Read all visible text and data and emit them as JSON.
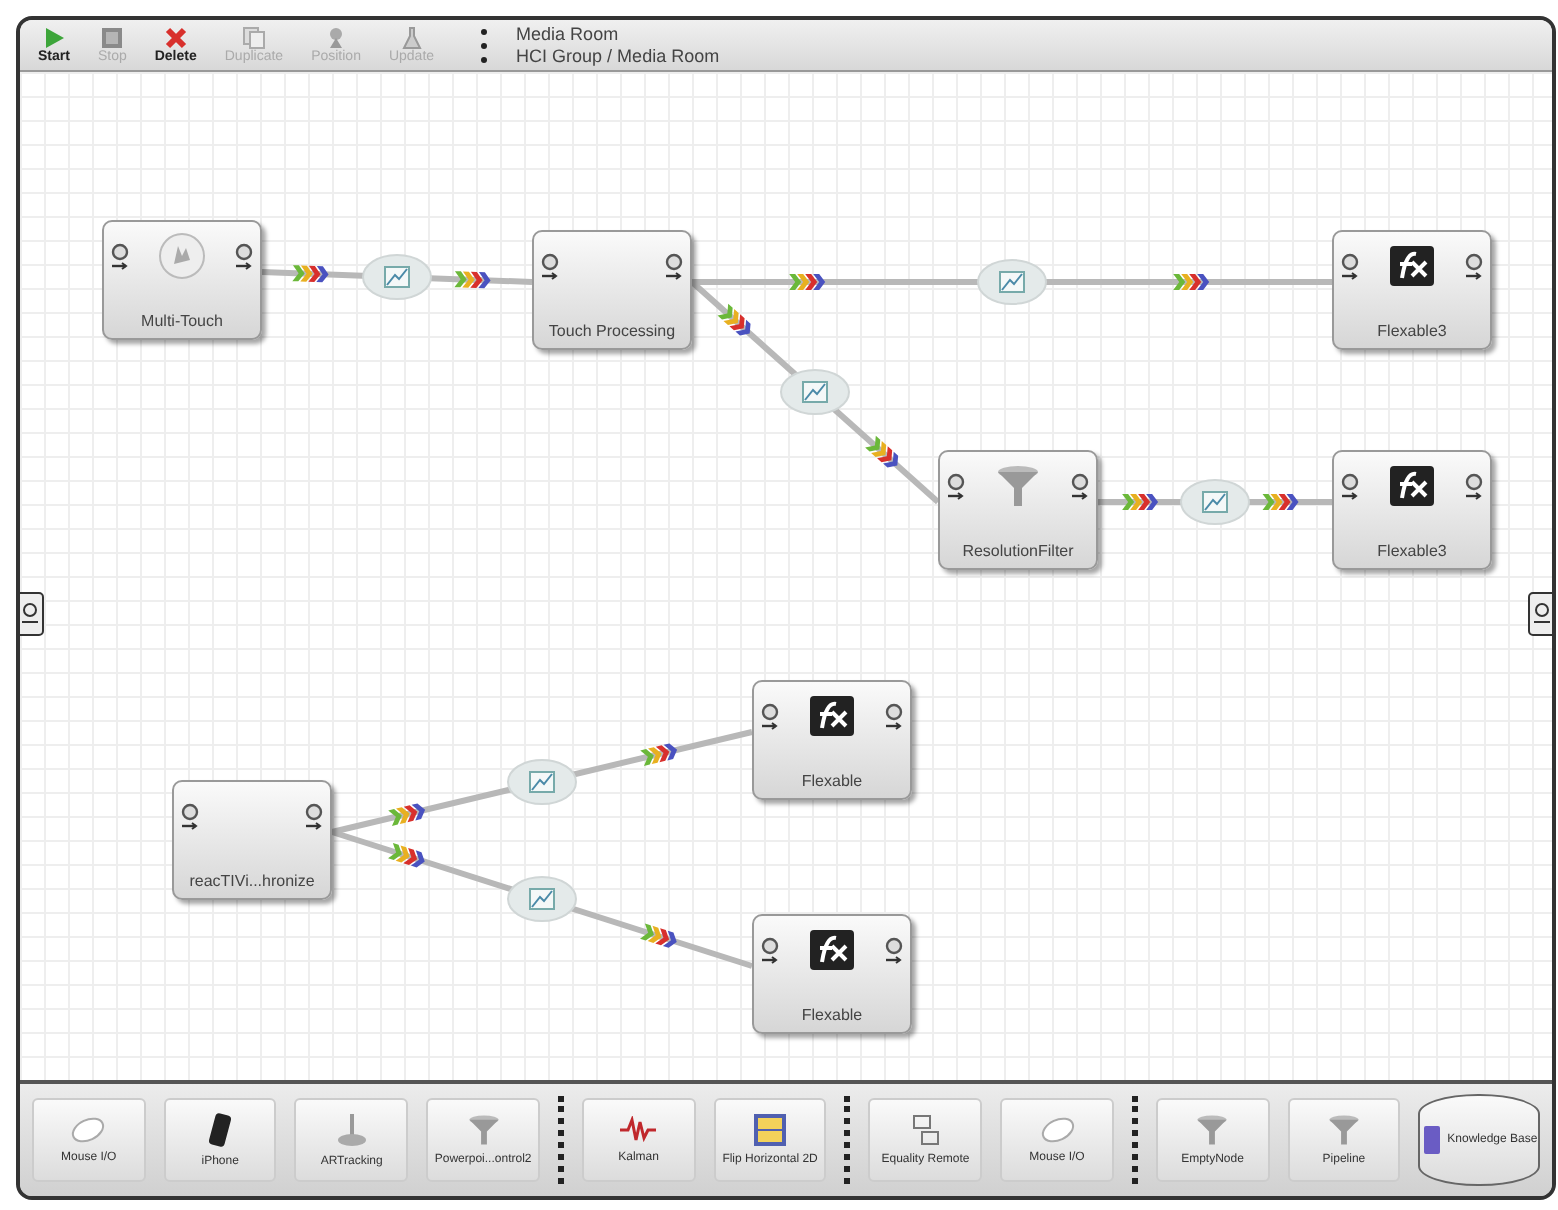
{
  "toolbar": {
    "buttons": [
      {
        "label": "Start",
        "kind": "play",
        "disabled": false
      },
      {
        "label": "Stop",
        "kind": "stop",
        "disabled": true
      },
      {
        "label": "Delete",
        "kind": "delete",
        "disabled": false
      },
      {
        "label": "Duplicate",
        "kind": "duplicate",
        "disabled": true
      },
      {
        "label": "Position",
        "kind": "position",
        "disabled": true
      },
      {
        "label": "Update",
        "kind": "update",
        "disabled": true
      }
    ],
    "title": "Media Room",
    "path": "HCI Group / Media Room"
  },
  "canvas": {
    "nodes": [
      {
        "label": "Multi-Touch",
        "kind": "hand"
      },
      {
        "label": "Touch Processing",
        "kind": "none"
      },
      {
        "label": "Flexable3",
        "kind": "fx"
      },
      {
        "label": "ResolutionFilter",
        "kind": "funnel"
      },
      {
        "label": "Flexable3",
        "kind": "fx"
      },
      {
        "label": "reacTIVi...hronize",
        "kind": "none"
      },
      {
        "label": "Flexable",
        "kind": "fx"
      },
      {
        "label": "Flexable",
        "kind": "fx"
      }
    ]
  },
  "palette": {
    "groups": [
      [
        {
          "label": "Mouse I/O",
          "kind": "mouse"
        },
        {
          "label": "iPhone",
          "kind": "phone"
        },
        {
          "label": "ARTracking",
          "kind": "joystick"
        },
        {
          "label": "Powerpoi...ontrol2",
          "kind": "funnel"
        }
      ],
      [
        {
          "label": "Kalman",
          "kind": "wave"
        },
        {
          "label": "Flip Horizontal 2D",
          "kind": "flip"
        }
      ],
      [
        {
          "label": "Equality Remote",
          "kind": "equality"
        },
        {
          "label": "Mouse I/O",
          "kind": "mouse"
        }
      ],
      [
        {
          "label": "EmptyNode",
          "kind": "funnel"
        },
        {
          "label": "Pipeline",
          "kind": "funnel"
        },
        {
          "label": "Knowledge Base",
          "kind": "database"
        }
      ]
    ]
  }
}
